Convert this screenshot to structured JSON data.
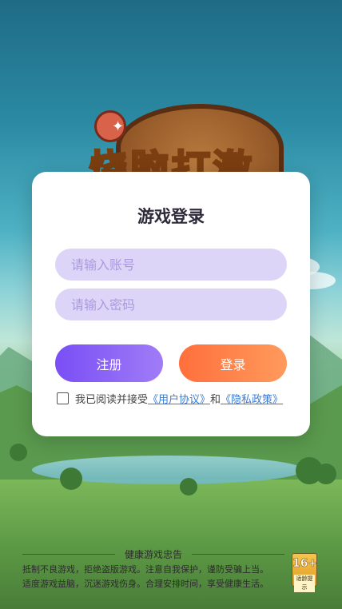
{
  "logo": {
    "text": "烧脑打激"
  },
  "dialog": {
    "title": "游戏登录",
    "account_placeholder": "请输入账号",
    "password_placeholder": "请输入密码",
    "register_label": "注册",
    "login_label": "登录",
    "agreement": {
      "prefix": "我已阅读并接受",
      "user_agreement_link": "《用户协议》",
      "and": "和",
      "privacy_policy_link": "《隐私政策》",
      "checked": false
    }
  },
  "footer": {
    "title": "健康游戏忠告",
    "line1": "抵制不良游戏，拒绝盗版游戏。注意自我保护，谨防受骗上当。",
    "line2": "适度游戏益脑，沉迷游戏伤身。合理安排时间，享受健康生活。"
  },
  "age_rating": {
    "number": "16+",
    "label": "适龄提示"
  },
  "colors": {
    "register_button": "#7a4ef5",
    "login_button": "#ff6f3c",
    "input_background": "#ddd5f7",
    "link": "#3a7bd5"
  },
  "icons": {
    "checkbox": "checkbox-icon"
  }
}
